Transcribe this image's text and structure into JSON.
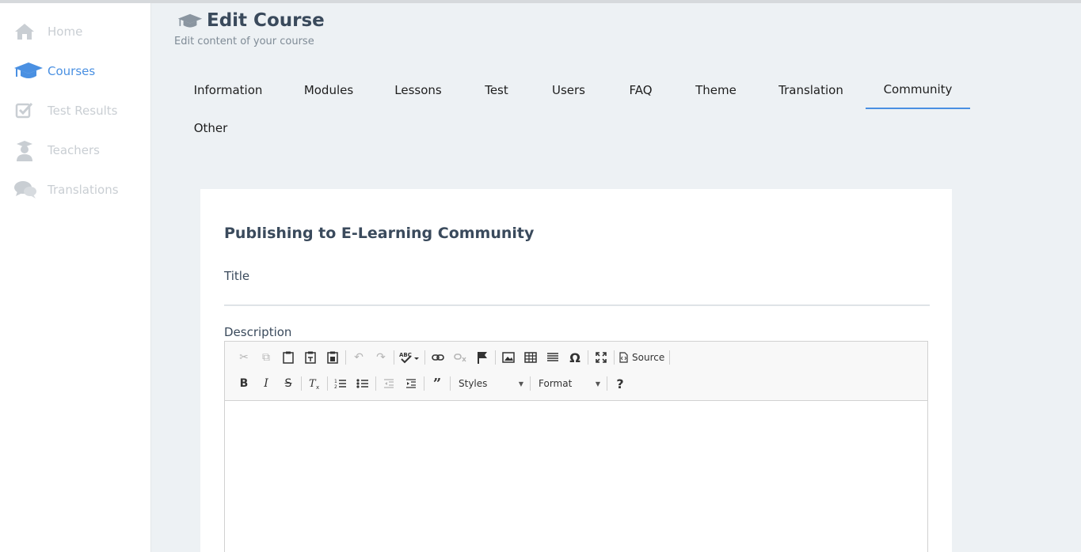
{
  "sidebar": {
    "items": [
      {
        "label": "Home",
        "icon": "home-icon",
        "active": false
      },
      {
        "label": "Courses",
        "icon": "graduation-cap-icon",
        "active": true
      },
      {
        "label": "Test Results",
        "icon": "checkbox-icon",
        "active": false
      },
      {
        "label": "Teachers",
        "icon": "teacher-icon",
        "active": false
      },
      {
        "label": "Translations",
        "icon": "chat-bubbles-icon",
        "active": false
      }
    ]
  },
  "header": {
    "title": "Edit Course",
    "subtitle": "Edit content of your course",
    "icon": "graduation-cap-icon"
  },
  "tabs": [
    {
      "label": "Information"
    },
    {
      "label": "Modules"
    },
    {
      "label": "Lessons"
    },
    {
      "label": "Test"
    },
    {
      "label": "Users"
    },
    {
      "label": "FAQ"
    },
    {
      "label": "Theme"
    },
    {
      "label": "Translation"
    },
    {
      "label": "Community",
      "active": true
    },
    {
      "label": "Other"
    }
  ],
  "form": {
    "heading": "Publishing to E-Learning Community",
    "title_label": "Title",
    "title_value": "",
    "description_label": "Description"
  },
  "editor": {
    "source_label": "Source",
    "styles_label": "Styles",
    "format_label": "Format",
    "help_label": "?"
  },
  "colors": {
    "accent": "#4a90e2",
    "sidebar_inactive": "#c9ced3",
    "background": "#edf1f4",
    "heading": "#3a4a5c"
  }
}
